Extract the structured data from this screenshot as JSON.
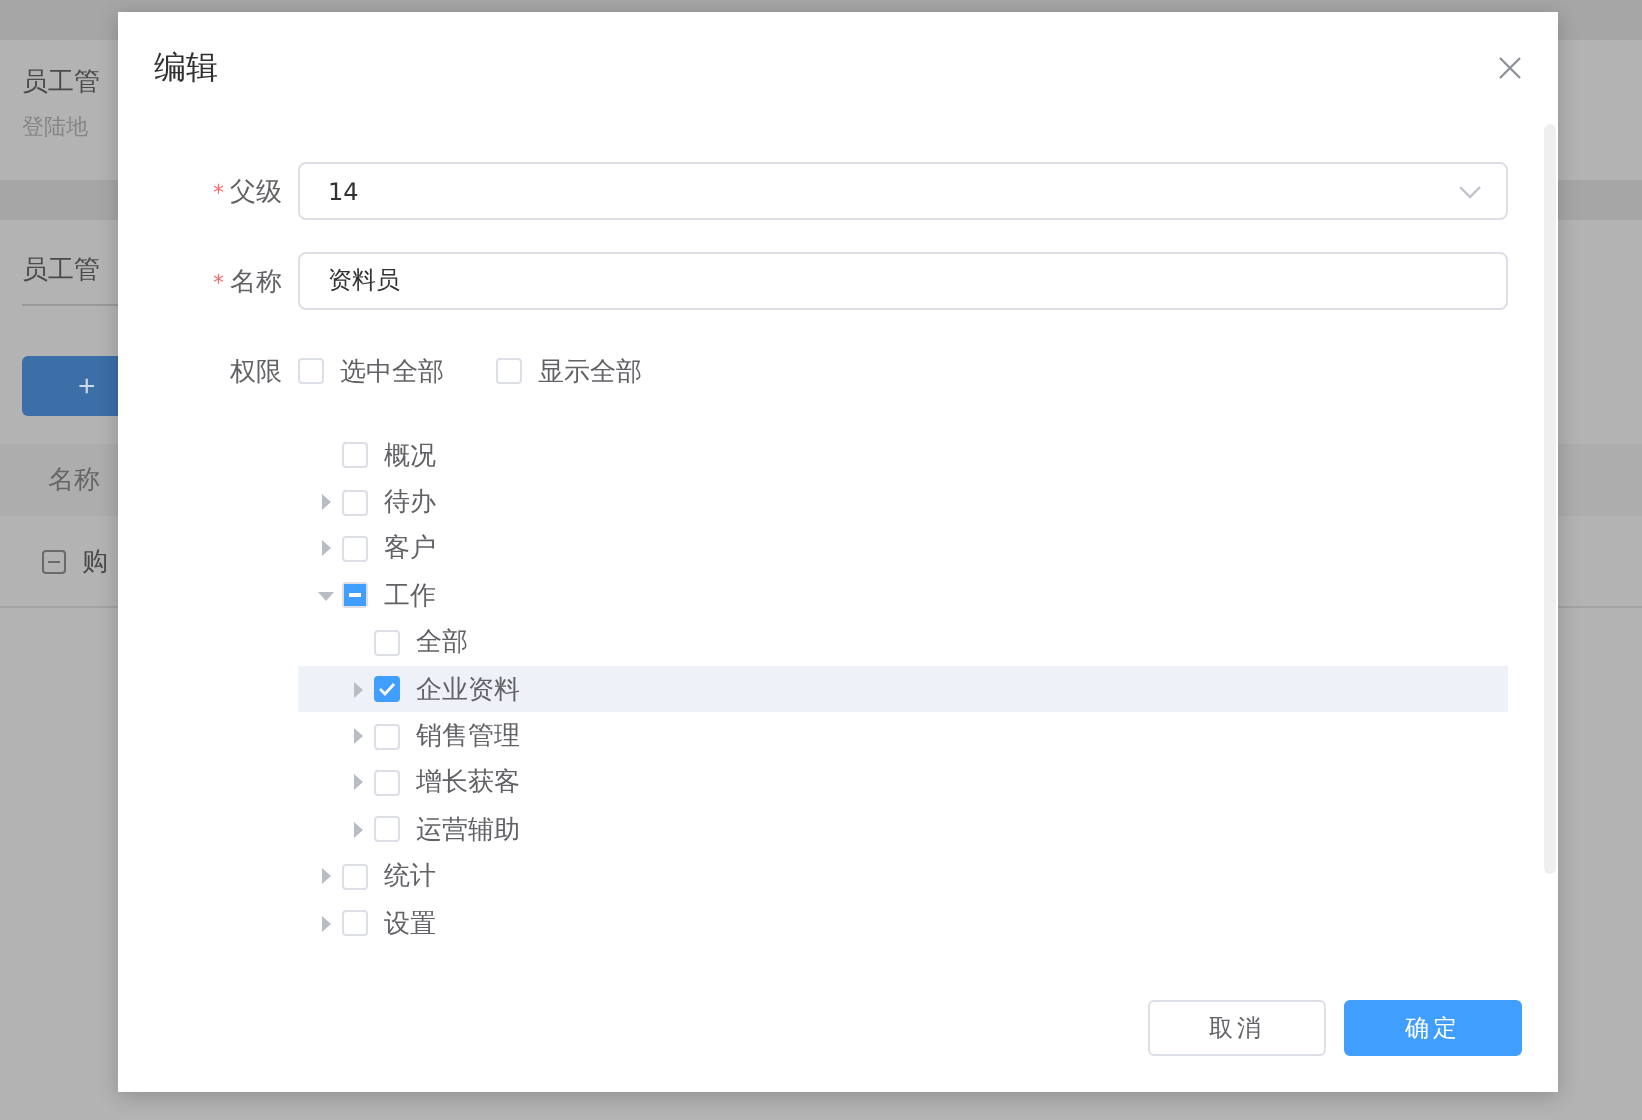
{
  "background": {
    "header_title": "员工管",
    "header_subtitle": "登陆地",
    "section_title": "员工管",
    "add_button": "+",
    "table_header": "名称",
    "rows": [
      {
        "label": "购",
        "expanded": true
      }
    ]
  },
  "dialog": {
    "title": "编辑",
    "fields": [
      {
        "label": "父级",
        "required_mark": "*",
        "kind": "select",
        "value": "14"
      },
      {
        "label": "名称",
        "required_mark": "*",
        "kind": "input",
        "value": "资料员"
      }
    ],
    "permissions": {
      "label": "权限",
      "options": [
        {
          "label": "选中全部",
          "checked": false
        },
        {
          "label": "显示全部",
          "checked": false
        }
      ],
      "tree": [
        {
          "label": "概况",
          "kind": "leaf",
          "checked": false,
          "indeterminate": false,
          "selected": false
        },
        {
          "label": "待办",
          "kind": "branch",
          "expanded": false,
          "checked": false,
          "indeterminate": false,
          "selected": false
        },
        {
          "label": "客户",
          "kind": "branch",
          "expanded": false,
          "checked": false,
          "indeterminate": false,
          "selected": false
        },
        {
          "label": "工作",
          "kind": "branch",
          "expanded": true,
          "checked": false,
          "indeterminate": true,
          "selected": false,
          "children": [
            {
              "label": "全部",
              "kind": "leaf",
              "checked": false,
              "indeterminate": false,
              "selected": false
            },
            {
              "label": "企业资料",
              "kind": "branch",
              "expanded": false,
              "checked": true,
              "indeterminate": false,
              "selected": true
            },
            {
              "label": "销售管理",
              "kind": "branch",
              "expanded": false,
              "checked": false,
              "indeterminate": false,
              "selected": false
            },
            {
              "label": "增长获客",
              "kind": "branch",
              "expanded": false,
              "checked": false,
              "indeterminate": false,
              "selected": false
            },
            {
              "label": "运营辅助",
              "kind": "branch",
              "expanded": false,
              "checked": false,
              "indeterminate": false,
              "selected": false
            }
          ]
        },
        {
          "label": "统计",
          "kind": "branch",
          "expanded": false,
          "checked": false,
          "indeterminate": false,
          "selected": false
        },
        {
          "label": "设置",
          "kind": "branch",
          "expanded": false,
          "checked": false,
          "indeterminate": false,
          "selected": false
        }
      ]
    },
    "buttons": [
      {
        "label": "取消",
        "kind": "default"
      },
      {
        "label": "确定",
        "kind": "primary"
      }
    ]
  }
}
